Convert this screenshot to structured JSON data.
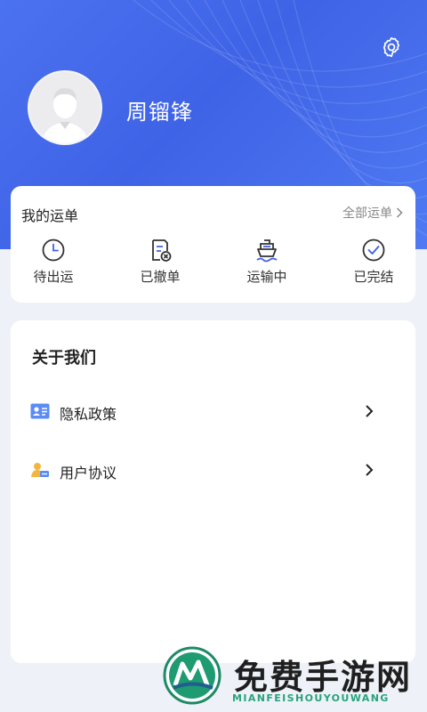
{
  "profile": {
    "username": "周镏锋",
    "avatar_icon": "user-avatar-placeholder"
  },
  "settings": {
    "icon": "gear-icon"
  },
  "orders": {
    "title": "我的运单",
    "view_all": "全部运单",
    "items": [
      {
        "label": "待出运",
        "icon": "clock-icon"
      },
      {
        "label": "已撤单",
        "icon": "document-cancel-icon"
      },
      {
        "label": "运输中",
        "icon": "ship-icon"
      },
      {
        "label": "已完结",
        "icon": "check-circle-icon"
      }
    ]
  },
  "about": {
    "title": "关于我们",
    "items": [
      {
        "label": "隐私政策",
        "icon": "id-card-icon"
      },
      {
        "label": "用户协议",
        "icon": "user-agreement-icon"
      }
    ]
  },
  "watermark": {
    "title": "免费手游网",
    "subtitle": "MIANFEISHOUYOUWANG"
  },
  "colors": {
    "header_blue": "#4b72f0",
    "accent": "#3f63e6",
    "background": "#eef2f8"
  }
}
